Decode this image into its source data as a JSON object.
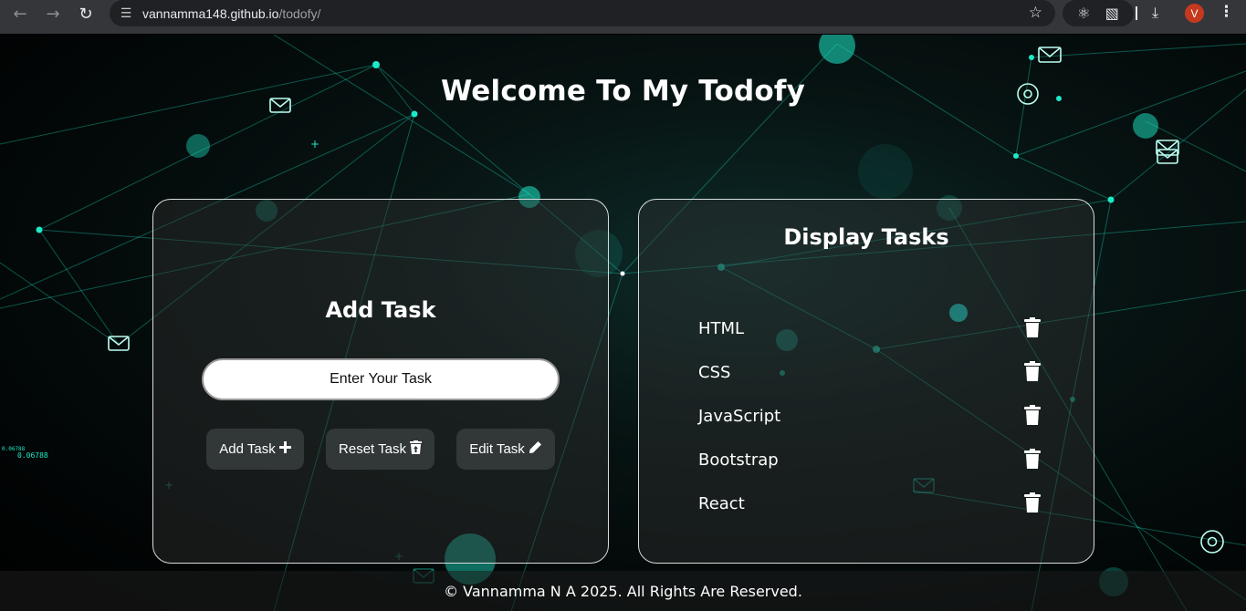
{
  "browser": {
    "url_host": "vannamma148.github.io",
    "url_path": "/todofy/",
    "profile_initial": "V"
  },
  "page": {
    "heading": "Welcome To My Todofy",
    "add_panel": {
      "title": "Add Task",
      "input_placeholder": "Enter Your Task",
      "buttons": {
        "add": "Add Task",
        "reset": "Reset Task",
        "edit": "Edit Task"
      }
    },
    "display_panel": {
      "title": "Display Tasks",
      "tasks": [
        "HTML",
        "CSS",
        "JavaScript",
        "Bootstrap",
        "React"
      ]
    },
    "footer": "© Vannamma N A 2025. All Rights Are Reserved.",
    "background_readouts": [
      "0.06788",
      "0.06788"
    ]
  },
  "colors": {
    "accent": "#1de9c8",
    "card_border": "#d8dcdc",
    "avatar": "#c5391e"
  }
}
